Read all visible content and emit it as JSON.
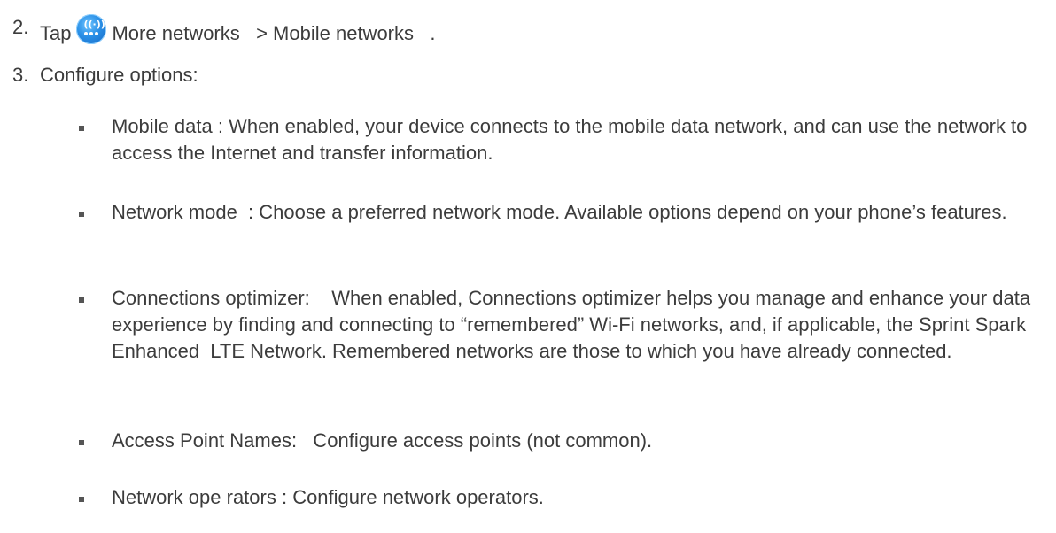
{
  "steps": [
    {
      "number": "2.",
      "prefix": "Tap",
      "icon": "more-networks-icon",
      "suffix": "More networks   > Mobile networks   ."
    },
    {
      "number": "3.",
      "text": "Configure options:"
    }
  ],
  "options": [
    {
      "text": "Mobile data : When enabled, your device connects to the mobile data network, and can use the network to access the Internet and transfer information."
    },
    {
      "text": "Network mode  : Choose a preferred network mode. Available options depend on your phone’s features."
    },
    {
      "text": "Connections optimizer:    When enabled, Connections optimizer helps you manage and enhance your data experience by finding and connecting to “remembered” Wi-Fi networks, and, if applicable, the Sprint Spark Enhanced  LTE Network. Remembered networks are those to which you have already connected."
    },
    {
      "text": "Access Point Names:   Configure access points (not common)."
    },
    {
      "text": "Network ope rators : Configure network operators."
    }
  ],
  "colors": {
    "text": "#3c3c3c",
    "icon_blue": "#2a8fe6"
  }
}
